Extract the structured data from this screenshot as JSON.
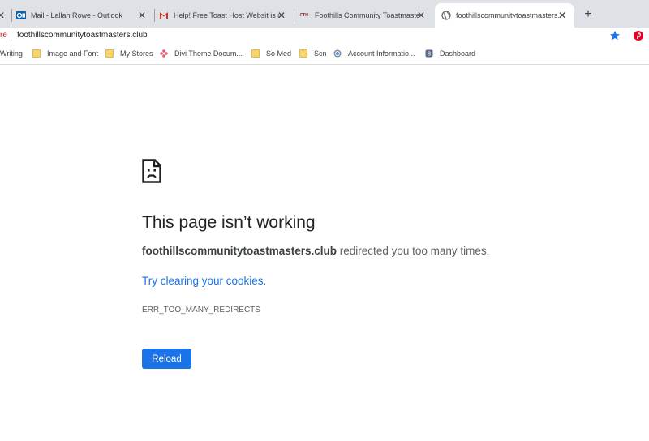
{
  "tabs": [
    {
      "title": "",
      "close": "✕"
    },
    {
      "title": "Mail - Lallah Rowe - Outlook",
      "close": "✕",
      "icon": "outlook-icon"
    },
    {
      "title": "Help! Free Toast Host Websit is d",
      "close": "✕",
      "icon": "gmail-icon"
    },
    {
      "title": "Foothills Community Toastmaste",
      "close": "✕",
      "icon": "fth-icon",
      "favicon_text": "FTH"
    },
    {
      "title": "foothillscommunitytoastmasters.",
      "close": "✕",
      "icon": "globe-icon",
      "active": true
    }
  ],
  "new_tab": "+",
  "omnibox": {
    "security_text": "re",
    "url": "foothillscommunitytoastmasters.club"
  },
  "bookmarks": [
    {
      "label": "Writing"
    },
    {
      "label": "Image and Font",
      "icon": "folder-icon"
    },
    {
      "label": "My Stores",
      "icon": "folder-icon"
    },
    {
      "label": "Divi Theme Docum...",
      "icon": "divi-icon"
    },
    {
      "label": "So Med",
      "icon": "folder-icon"
    },
    {
      "label": "Scn",
      "icon": "folder-icon"
    },
    {
      "label": "Account Informatio...",
      "icon": "account-icon"
    },
    {
      "label": "Dashboard",
      "icon": "dashboard-icon"
    }
  ],
  "error": {
    "title": "This page isn’t working",
    "domain": "foothillscommunitytoastmasters.club",
    "message_rest": " redirected you too many times.",
    "link": "Try clearing your cookies.",
    "code": "ERR_TOO_MANY_REDIRECTS",
    "reload_label": "Reload"
  },
  "colors": {
    "accent": "#1a73e8",
    "tabstrip": "#dee1e6",
    "star": "#1a73e8",
    "pinterest": "#e60023"
  }
}
